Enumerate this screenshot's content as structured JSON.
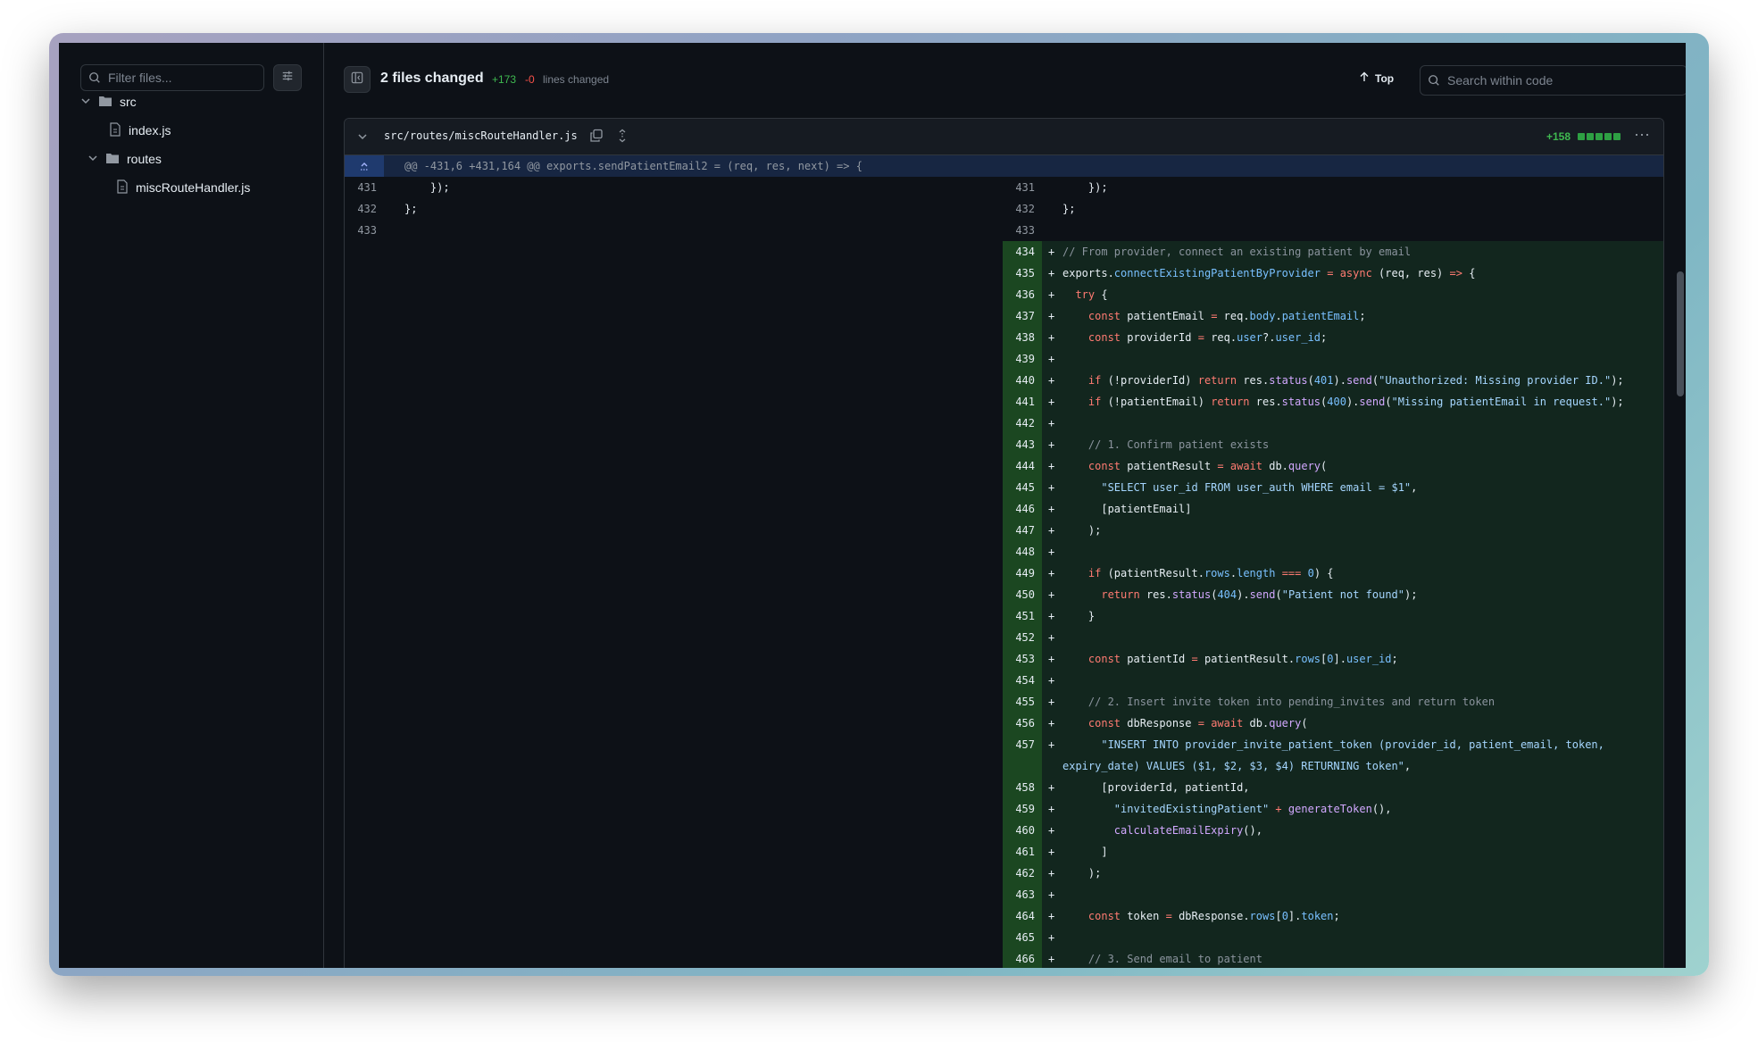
{
  "sidebar": {
    "filter_placeholder": "Filter files...",
    "tree": [
      {
        "label": "src",
        "type": "folder"
      },
      {
        "label": "index.js",
        "type": "file"
      },
      {
        "label": "routes",
        "type": "folder"
      },
      {
        "label": "miscRouteHandler.js",
        "type": "file"
      }
    ]
  },
  "header": {
    "title": "2 files changed",
    "additions": "+173",
    "deletions": "-0",
    "lines_label": "lines changed",
    "top_label": "Top",
    "search_placeholder": "Search within code"
  },
  "file": {
    "path": "src/routes/miscRouteHandler.js",
    "diffstat": "+158",
    "hunk_header": "@@ -431,6 +431,164 @@ exports.sendPatientEmail2 = (req, res, next) => {"
  },
  "left_lines": [
    {
      "num": "431",
      "code": "    });"
    },
    {
      "num": "432",
      "code": "};"
    },
    {
      "num": "433",
      "code": ""
    }
  ],
  "right_lines": [
    {
      "num": "431",
      "code": "    });",
      "added": false
    },
    {
      "num": "432",
      "code": "};",
      "added": false
    },
    {
      "num": "433",
      "code": "",
      "added": false
    },
    {
      "num": "434",
      "code": "// From provider, connect an existing patient by email",
      "added": true
    },
    {
      "num": "435",
      "code": "exports.connectExistingPatientByProvider = async (req, res) => {",
      "added": true
    },
    {
      "num": "436",
      "code": "  try {",
      "added": true
    },
    {
      "num": "437",
      "code": "    const patientEmail = req.body.patientEmail;",
      "added": true
    },
    {
      "num": "438",
      "code": "    const providerId = req.user?.user_id;",
      "added": true
    },
    {
      "num": "439",
      "code": "",
      "added": true
    },
    {
      "num": "440",
      "code": "    if (!providerId) return res.status(401).send(\"Unauthorized: Missing provider ID.\");",
      "added": true
    },
    {
      "num": "441",
      "code": "    if (!patientEmail) return res.status(400).send(\"Missing patientEmail in request.\");",
      "added": true
    },
    {
      "num": "442",
      "code": "",
      "added": true
    },
    {
      "num": "443",
      "code": "    // 1. Confirm patient exists",
      "added": true
    },
    {
      "num": "444",
      "code": "    const patientResult = await db.query(",
      "added": true
    },
    {
      "num": "445",
      "code": "      \"SELECT user_id FROM user_auth WHERE email = $1\",",
      "added": true
    },
    {
      "num": "446",
      "code": "      [patientEmail]",
      "added": true
    },
    {
      "num": "447",
      "code": "    );",
      "added": true
    },
    {
      "num": "448",
      "code": "",
      "added": true
    },
    {
      "num": "449",
      "code": "    if (patientResult.rows.length === 0) {",
      "added": true
    },
    {
      "num": "450",
      "code": "      return res.status(404).send(\"Patient not found\");",
      "added": true
    },
    {
      "num": "451",
      "code": "    }",
      "added": true
    },
    {
      "num": "452",
      "code": "",
      "added": true
    },
    {
      "num": "453",
      "code": "    const patientId = patientResult.rows[0].user_id;",
      "added": true
    },
    {
      "num": "454",
      "code": "",
      "added": true
    },
    {
      "num": "455",
      "code": "    // 2. Insert invite token into pending_invites and return token",
      "added": true
    },
    {
      "num": "456",
      "code": "    const dbResponse = await db.query(",
      "added": true
    },
    {
      "num": "457",
      "code": "      \"INSERT INTO provider_invite_patient_token (provider_id, patient_email, token, expiry_date) VALUES ($1, $2, $3, $4) RETURNING token\",",
      "added": true,
      "tall": true
    },
    {
      "num": "458",
      "code": "      [providerId, patientId,",
      "added": true
    },
    {
      "num": "459",
      "code": "        \"invitedExistingPatient\" + generateToken(),",
      "added": true
    },
    {
      "num": "460",
      "code": "        calculateEmailExpiry(),",
      "added": true
    },
    {
      "num": "461",
      "code": "      ]",
      "added": true
    },
    {
      "num": "462",
      "code": "    );",
      "added": true
    },
    {
      "num": "463",
      "code": "",
      "added": true
    },
    {
      "num": "464",
      "code": "    const token = dbResponse.rows[0].token;",
      "added": true
    },
    {
      "num": "465",
      "code": "",
      "added": true
    },
    {
      "num": "466",
      "code": "    // 3. Send email to patient",
      "added": true
    }
  ]
}
